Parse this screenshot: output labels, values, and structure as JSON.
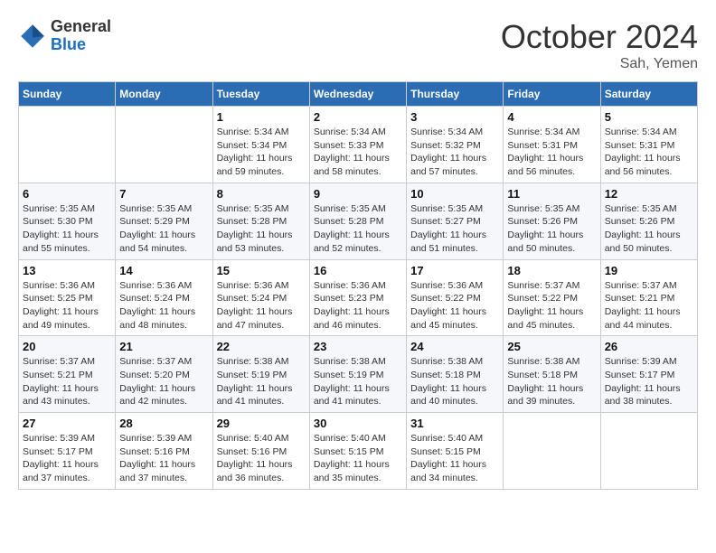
{
  "header": {
    "logo_general": "General",
    "logo_blue": "Blue",
    "month_title": "October 2024",
    "subtitle": "Sah, Yemen"
  },
  "days_of_week": [
    "Sunday",
    "Monday",
    "Tuesday",
    "Wednesday",
    "Thursday",
    "Friday",
    "Saturday"
  ],
  "weeks": [
    [
      {
        "day": "",
        "info": ""
      },
      {
        "day": "",
        "info": ""
      },
      {
        "day": "1",
        "info": "Sunrise: 5:34 AM\nSunset: 5:34 PM\nDaylight: 11 hours and 59 minutes."
      },
      {
        "day": "2",
        "info": "Sunrise: 5:34 AM\nSunset: 5:33 PM\nDaylight: 11 hours and 58 minutes."
      },
      {
        "day": "3",
        "info": "Sunrise: 5:34 AM\nSunset: 5:32 PM\nDaylight: 11 hours and 57 minutes."
      },
      {
        "day": "4",
        "info": "Sunrise: 5:34 AM\nSunset: 5:31 PM\nDaylight: 11 hours and 56 minutes."
      },
      {
        "day": "5",
        "info": "Sunrise: 5:34 AM\nSunset: 5:31 PM\nDaylight: 11 hours and 56 minutes."
      }
    ],
    [
      {
        "day": "6",
        "info": "Sunrise: 5:35 AM\nSunset: 5:30 PM\nDaylight: 11 hours and 55 minutes."
      },
      {
        "day": "7",
        "info": "Sunrise: 5:35 AM\nSunset: 5:29 PM\nDaylight: 11 hours and 54 minutes."
      },
      {
        "day": "8",
        "info": "Sunrise: 5:35 AM\nSunset: 5:28 PM\nDaylight: 11 hours and 53 minutes."
      },
      {
        "day": "9",
        "info": "Sunrise: 5:35 AM\nSunset: 5:28 PM\nDaylight: 11 hours and 52 minutes."
      },
      {
        "day": "10",
        "info": "Sunrise: 5:35 AM\nSunset: 5:27 PM\nDaylight: 11 hours and 51 minutes."
      },
      {
        "day": "11",
        "info": "Sunrise: 5:35 AM\nSunset: 5:26 PM\nDaylight: 11 hours and 50 minutes."
      },
      {
        "day": "12",
        "info": "Sunrise: 5:35 AM\nSunset: 5:26 PM\nDaylight: 11 hours and 50 minutes."
      }
    ],
    [
      {
        "day": "13",
        "info": "Sunrise: 5:36 AM\nSunset: 5:25 PM\nDaylight: 11 hours and 49 minutes."
      },
      {
        "day": "14",
        "info": "Sunrise: 5:36 AM\nSunset: 5:24 PM\nDaylight: 11 hours and 48 minutes."
      },
      {
        "day": "15",
        "info": "Sunrise: 5:36 AM\nSunset: 5:24 PM\nDaylight: 11 hours and 47 minutes."
      },
      {
        "day": "16",
        "info": "Sunrise: 5:36 AM\nSunset: 5:23 PM\nDaylight: 11 hours and 46 minutes."
      },
      {
        "day": "17",
        "info": "Sunrise: 5:36 AM\nSunset: 5:22 PM\nDaylight: 11 hours and 45 minutes."
      },
      {
        "day": "18",
        "info": "Sunrise: 5:37 AM\nSunset: 5:22 PM\nDaylight: 11 hours and 45 minutes."
      },
      {
        "day": "19",
        "info": "Sunrise: 5:37 AM\nSunset: 5:21 PM\nDaylight: 11 hours and 44 minutes."
      }
    ],
    [
      {
        "day": "20",
        "info": "Sunrise: 5:37 AM\nSunset: 5:21 PM\nDaylight: 11 hours and 43 minutes."
      },
      {
        "day": "21",
        "info": "Sunrise: 5:37 AM\nSunset: 5:20 PM\nDaylight: 11 hours and 42 minutes."
      },
      {
        "day": "22",
        "info": "Sunrise: 5:38 AM\nSunset: 5:19 PM\nDaylight: 11 hours and 41 minutes."
      },
      {
        "day": "23",
        "info": "Sunrise: 5:38 AM\nSunset: 5:19 PM\nDaylight: 11 hours and 41 minutes."
      },
      {
        "day": "24",
        "info": "Sunrise: 5:38 AM\nSunset: 5:18 PM\nDaylight: 11 hours and 40 minutes."
      },
      {
        "day": "25",
        "info": "Sunrise: 5:38 AM\nSunset: 5:18 PM\nDaylight: 11 hours and 39 minutes."
      },
      {
        "day": "26",
        "info": "Sunrise: 5:39 AM\nSunset: 5:17 PM\nDaylight: 11 hours and 38 minutes."
      }
    ],
    [
      {
        "day": "27",
        "info": "Sunrise: 5:39 AM\nSunset: 5:17 PM\nDaylight: 11 hours and 37 minutes."
      },
      {
        "day": "28",
        "info": "Sunrise: 5:39 AM\nSunset: 5:16 PM\nDaylight: 11 hours and 37 minutes."
      },
      {
        "day": "29",
        "info": "Sunrise: 5:40 AM\nSunset: 5:16 PM\nDaylight: 11 hours and 36 minutes."
      },
      {
        "day": "30",
        "info": "Sunrise: 5:40 AM\nSunset: 5:15 PM\nDaylight: 11 hours and 35 minutes."
      },
      {
        "day": "31",
        "info": "Sunrise: 5:40 AM\nSunset: 5:15 PM\nDaylight: 11 hours and 34 minutes."
      },
      {
        "day": "",
        "info": ""
      },
      {
        "day": "",
        "info": ""
      }
    ]
  ]
}
